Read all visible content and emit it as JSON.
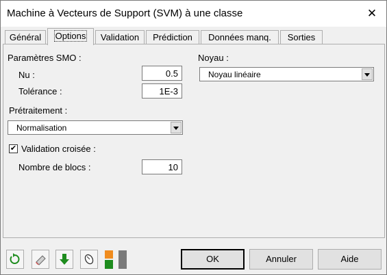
{
  "window": {
    "title": "Machine à Vecteurs de Support (SVM) à une classe",
    "close_glyph": "✕"
  },
  "tabs": [
    {
      "label": "Général"
    },
    {
      "label": "Options",
      "active": true
    },
    {
      "label": "Validation"
    },
    {
      "label": "Prédiction"
    },
    {
      "label": "Données manq."
    },
    {
      "label": "Sorties"
    }
  ],
  "options": {
    "smo_params_label": "Paramètres SMO :",
    "nu_label": "Nu :",
    "nu_value": "0.5",
    "tolerance_label": "Tolérance :",
    "tolerance_value": "1E-3",
    "preprocessing_label": "Prétraitement :",
    "preprocessing_value": "Normalisation",
    "cross_validation_label": "Validation croisée :",
    "cross_validation_checked": true,
    "cross_validation_mark": "✔",
    "blocks_label": "Nombre de blocs :",
    "blocks_value": "10",
    "kernel_label": "Noyau :",
    "kernel_value": "Noyau linéaire"
  },
  "footer": {
    "icons": [
      "reset-icon",
      "eraser-icon",
      "down-arrow-icon",
      "mouse-icon",
      "layout-toggle-icon"
    ],
    "ok_label": "OK",
    "cancel_label": "Annuler",
    "help_label": "Aide",
    "colors": {
      "green": "#1e8c1e",
      "orange": "#f08c1e",
      "gray": "#7a7a7a"
    }
  }
}
